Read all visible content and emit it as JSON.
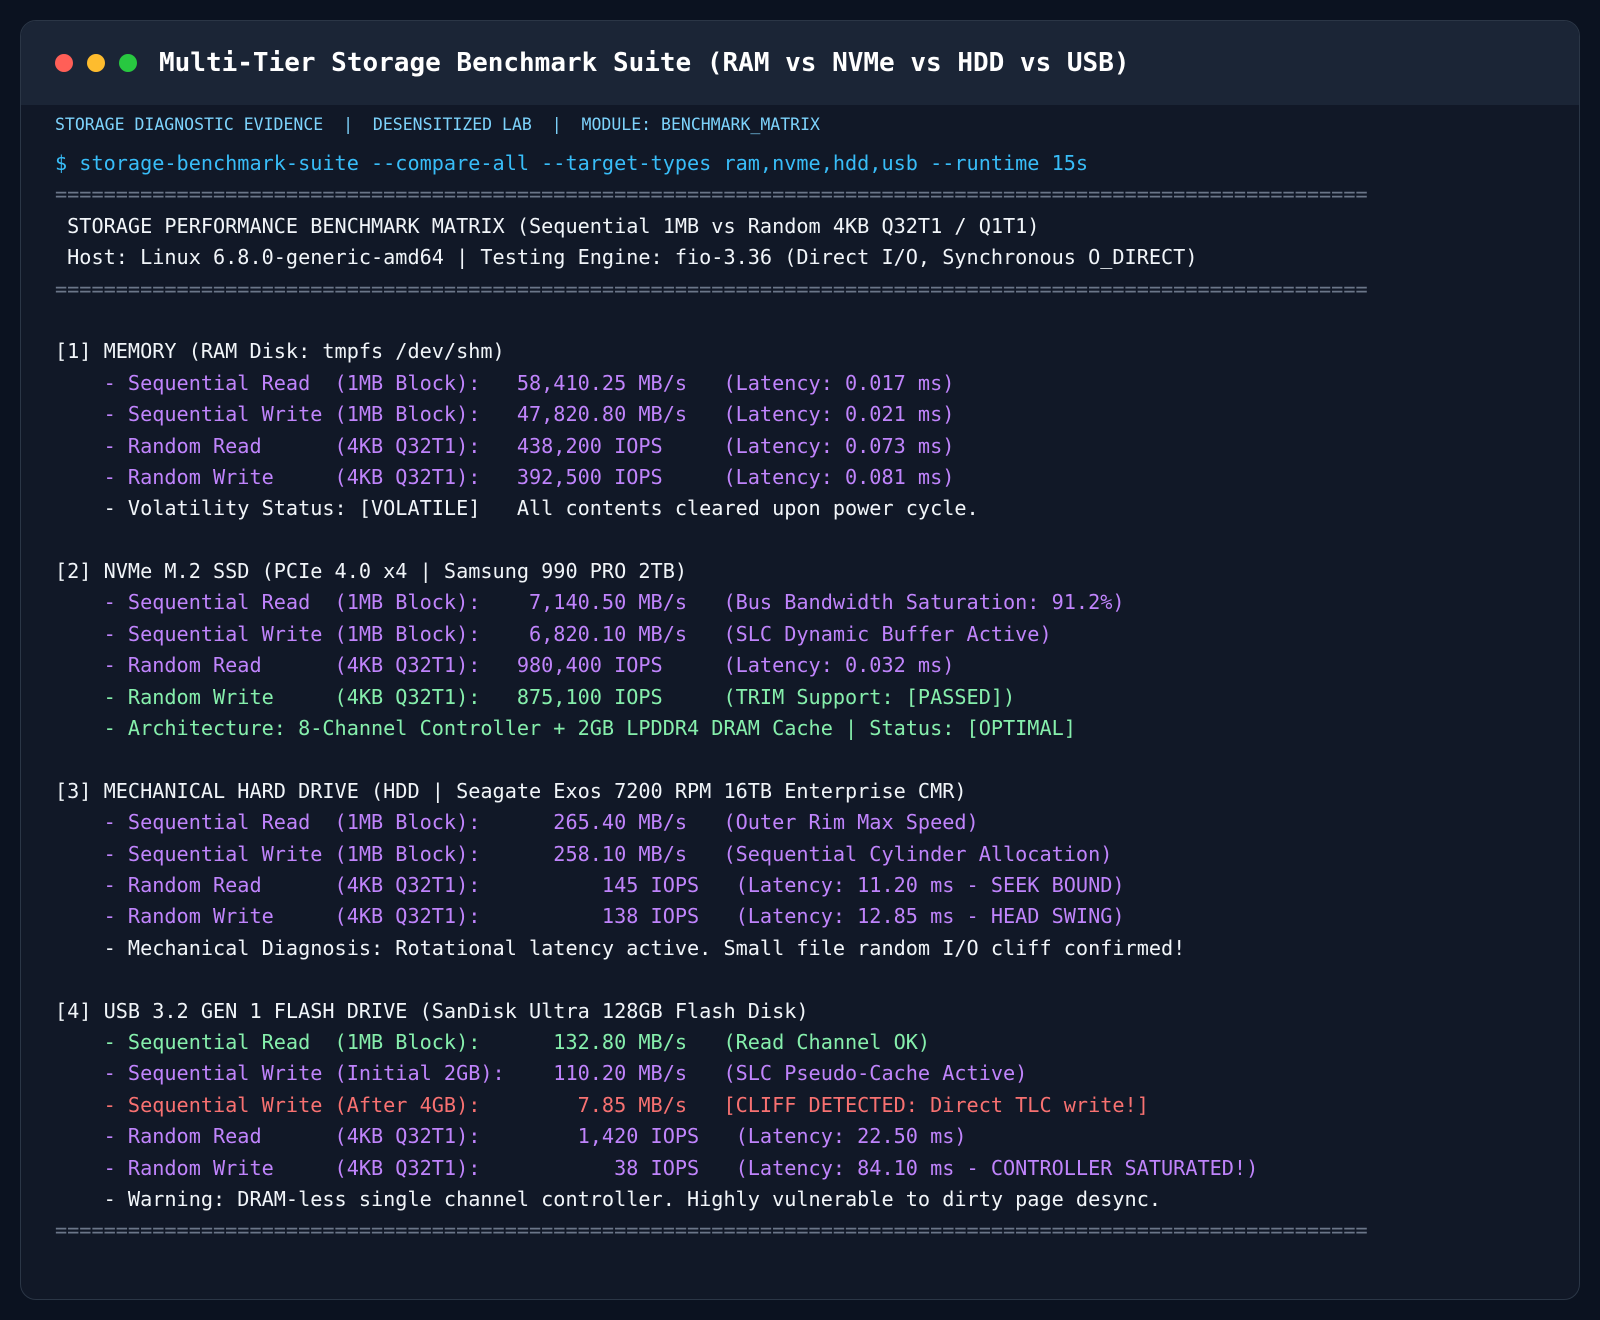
{
  "window": {
    "title": "Multi-Tier Storage Benchmark Suite (RAM vs NVMe vs HDD vs USB)"
  },
  "meta": {
    "evidence": "STORAGE DIAGNOSTIC EVIDENCE",
    "lab": "DESENSITIZED LAB",
    "module": "MODULE: BENCHMARK_MATRIX",
    "separator": "|"
  },
  "command": "$ storage-benchmark-suite --compare-all --target-types ram,nvme,hdd,usb --runtime 15s",
  "rule": "============================================================================================================",
  "header": {
    "title": " STORAGE PERFORMANCE BENCHMARK MATRIX (Sequential 1MB vs Random 4KB Q32T1 / Q1T1)",
    "host": " Host: Linux 6.8.0-generic-amd64 | Testing Engine: fio-3.36 (Direct I/O, Synchronous O_DIRECT)"
  },
  "sections": [
    {
      "heading": "[1] MEMORY (RAM Disk: tmpfs /dev/shm)",
      "lines": [
        {
          "text": "    - Sequential Read  (1MB Block):   58,410.25 MB/s   (Latency: 0.017 ms)",
          "color": "purple"
        },
        {
          "text": "    - Sequential Write (1MB Block):   47,820.80 MB/s   (Latency: 0.021 ms)",
          "color": "purple"
        },
        {
          "text": "    - Random Read      (4KB Q32T1):   438,200 IOPS     (Latency: 0.073 ms)",
          "color": "purple"
        },
        {
          "text": "    - Random Write     (4KB Q32T1):   392,500 IOPS     (Latency: 0.081 ms)",
          "color": "purple"
        },
        {
          "text": "    - Volatility Status: [VOLATILE]   All contents cleared upon power cycle.",
          "color": "white"
        }
      ]
    },
    {
      "heading": "[2] NVMe M.2 SSD (PCIe 4.0 x4 | Samsung 990 PRO 2TB)",
      "lines": [
        {
          "text": "    - Sequential Read  (1MB Block):    7,140.50 MB/s   (Bus Bandwidth Saturation: 91.2%)",
          "color": "purple"
        },
        {
          "text": "    - Sequential Write (1MB Block):    6,820.10 MB/s   (SLC Dynamic Buffer Active)",
          "color": "purple"
        },
        {
          "text": "    - Random Read      (4KB Q32T1):   980,400 IOPS     (Latency: 0.032 ms)",
          "color": "purple"
        },
        {
          "text": "    - Random Write     (4KB Q32T1):   875,100 IOPS     (TRIM Support: [PASSED])",
          "color": "lgreen"
        },
        {
          "text": "    - Architecture: 8-Channel Controller + 2GB LPDDR4 DRAM Cache | Status: [OPTIMAL]",
          "color": "lgreen"
        }
      ]
    },
    {
      "heading": "[3] MECHANICAL HARD DRIVE (HDD | Seagate Exos 7200 RPM 16TB Enterprise CMR)",
      "lines": [
        {
          "text": "    - Sequential Read  (1MB Block):      265.40 MB/s   (Outer Rim Max Speed)",
          "color": "purple"
        },
        {
          "text": "    - Sequential Write (1MB Block):      258.10 MB/s   (Sequential Cylinder Allocation)",
          "color": "purple"
        },
        {
          "text": "    - Random Read      (4KB Q32T1):          145 IOPS   (Latency: 11.20 ms - SEEK BOUND)",
          "color": "purple"
        },
        {
          "text": "    - Random Write     (4KB Q32T1):          138 IOPS   (Latency: 12.85 ms - HEAD SWING)",
          "color": "purple"
        },
        {
          "text": "    - Mechanical Diagnosis: Rotational latency active. Small file random I/O cliff confirmed!",
          "color": "white"
        }
      ]
    },
    {
      "heading": "[4] USB 3.2 GEN 1 FLASH DRIVE (SanDisk Ultra 128GB Flash Disk)",
      "lines": [
        {
          "text": "    - Sequential Read  (1MB Block):      132.80 MB/s   (Read Channel OK)",
          "color": "lgreen"
        },
        {
          "text": "    - Sequential Write (Initial 2GB):    110.20 MB/s   (SLC Pseudo-Cache Active)",
          "color": "purple"
        },
        {
          "text": "    - Sequential Write (After 4GB):        7.85 MB/s   [CLIFF DETECTED: Direct TLC write!]",
          "color": "red"
        },
        {
          "text": "    - Random Read      (4KB Q32T1):        1,420 IOPS   (Latency: 22.50 ms)",
          "color": "purple"
        },
        {
          "text": "    - Random Write     (4KB Q32T1):           38 IOPS   (Latency: 84.10 ms - CONTROLLER SATURATED!)",
          "color": "purple"
        },
        {
          "text": "    - Warning: DRAM-less single channel controller. Highly vulnerable to dirty page desync.",
          "color": "white"
        }
      ]
    }
  ]
}
